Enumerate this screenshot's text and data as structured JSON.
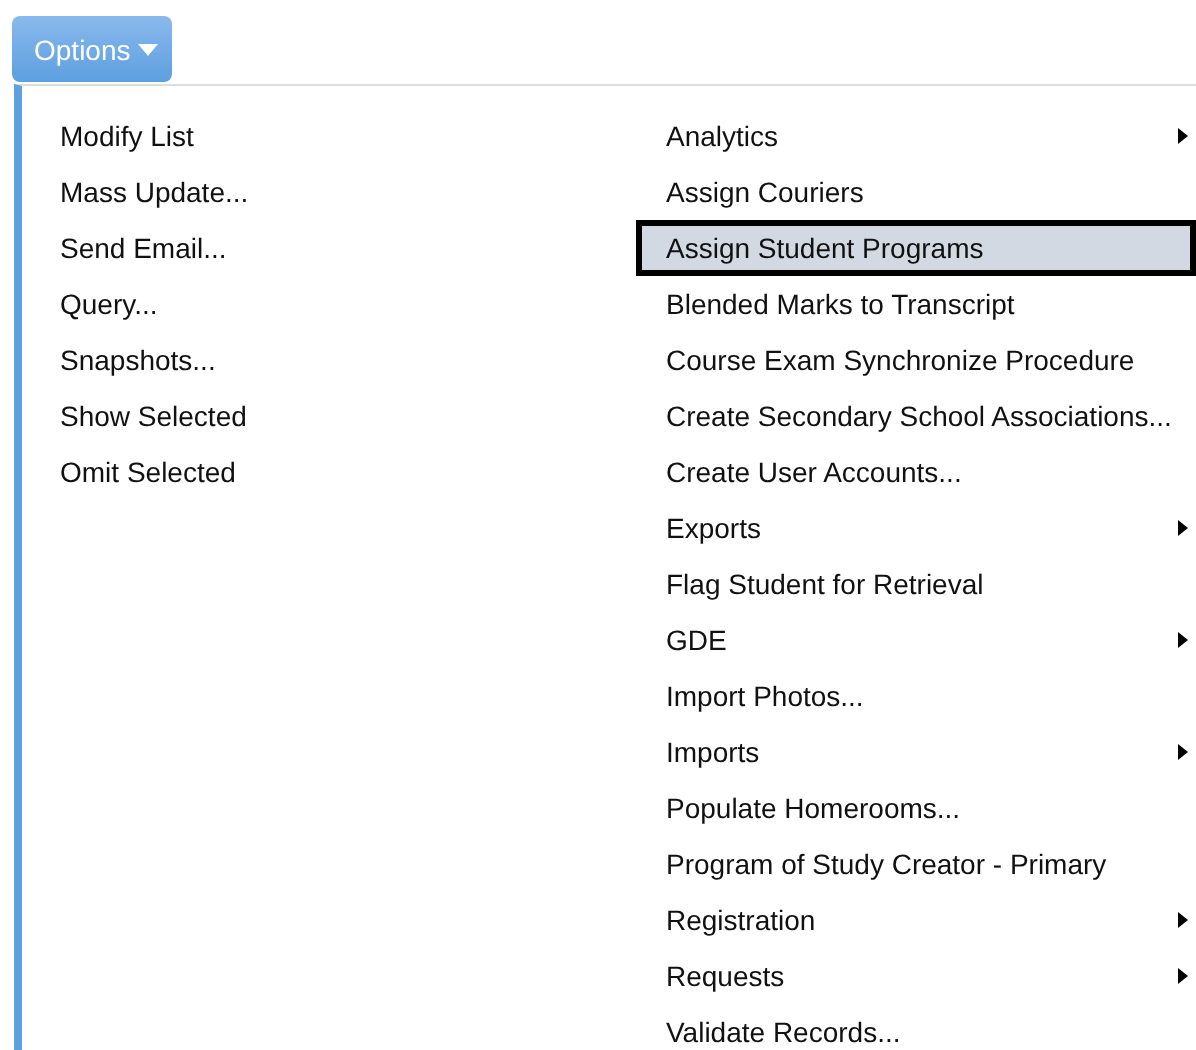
{
  "options_button": {
    "label": "Options"
  },
  "menu": {
    "left_items": [
      {
        "label": "Modify List"
      },
      {
        "label": "Mass Update..."
      },
      {
        "label": "Send Email..."
      },
      {
        "label": "Query..."
      },
      {
        "label": "Snapshots..."
      },
      {
        "label": "Show Selected"
      },
      {
        "label": "Omit Selected"
      }
    ],
    "right_items": [
      {
        "label": "Analytics",
        "submenu": true,
        "selected": false
      },
      {
        "label": "Assign Couriers",
        "submenu": false,
        "selected": false
      },
      {
        "label": "Assign Student Programs",
        "submenu": false,
        "selected": true
      },
      {
        "label": "Blended Marks to Transcript",
        "submenu": false,
        "selected": false
      },
      {
        "label": "Course Exam Synchronize Procedure",
        "submenu": false,
        "selected": false
      },
      {
        "label": "Create Secondary School Associations...",
        "submenu": false,
        "selected": false
      },
      {
        "label": "Create User Accounts...",
        "submenu": false,
        "selected": false
      },
      {
        "label": "Exports",
        "submenu": true,
        "selected": false
      },
      {
        "label": "Flag Student for Retrieval",
        "submenu": false,
        "selected": false
      },
      {
        "label": "GDE",
        "submenu": true,
        "selected": false
      },
      {
        "label": "Import Photos...",
        "submenu": false,
        "selected": false
      },
      {
        "label": "Imports",
        "submenu": true,
        "selected": false
      },
      {
        "label": "Populate Homerooms...",
        "submenu": false,
        "selected": false
      },
      {
        "label": "Program of Study Creator - Primary",
        "submenu": false,
        "selected": false
      },
      {
        "label": "Registration",
        "submenu": true,
        "selected": false
      },
      {
        "label": "Requests",
        "submenu": true,
        "selected": false
      },
      {
        "label": "Validate Records...",
        "submenu": false,
        "selected": false
      }
    ]
  }
}
